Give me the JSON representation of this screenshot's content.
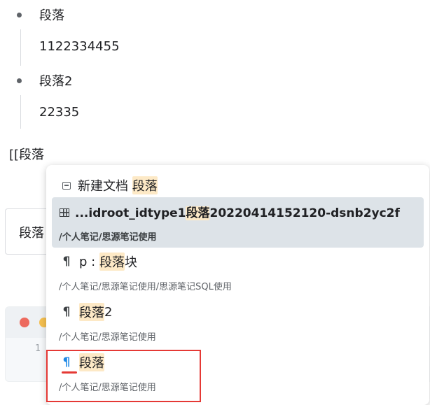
{
  "document": {
    "bullets": [
      {
        "label": "段落",
        "child": "1122334455"
      },
      {
        "label": "段落2",
        "child": "22335"
      }
    ],
    "typed_text": "[[段落"
  },
  "background": {
    "input_text": "段落",
    "code_line_number": "1",
    "mac_dot_colors": [
      "#ed6a5e",
      "#f5bf4f"
    ]
  },
  "popup": {
    "new_doc": {
      "icon": "document-icon",
      "prefix": "新建文档 ",
      "keyword": "段落"
    },
    "items": [
      {
        "icon": "table-icon",
        "title_pre": "...idroot_idtype1",
        "title_hl": "段落",
        "title_post": "20220414152120-dsnb2yc2f",
        "path": "/个人笔记/思源笔记使用",
        "selected": true
      },
      {
        "icon": "paragraph-icon",
        "title_pre": "p : ",
        "title_hl": "段落",
        "title_post": "块",
        "path": "/个人笔记/思源笔记使用/思源笔记SQL使用"
      },
      {
        "icon": "paragraph-icon",
        "title_pre": "",
        "title_hl": "段落",
        "title_post": "2",
        "path": "/个人笔记/思源笔记使用"
      },
      {
        "icon": "paragraph-icon",
        "title_pre": "",
        "title_hl": "段落",
        "title_post": "",
        "path": "/个人笔记/思源笔记使用",
        "annotated": true
      }
    ],
    "paragraph_glyph": "¶"
  },
  "colors": {
    "highlight": "#fde9c6",
    "selected_row": "#dde3e8",
    "annotation_red": "#e53935",
    "icon_blue": "#1e88e5"
  }
}
